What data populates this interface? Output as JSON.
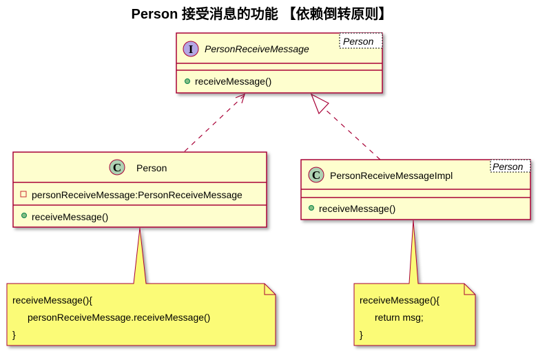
{
  "title": "Person 接受消息的功能 【依赖倒转原则】",
  "interface": {
    "stereotype_letter": "I",
    "name": "PersonReceiveMessage",
    "generic": "Person",
    "methods": [
      "receiveMessage()"
    ]
  },
  "person": {
    "stereotype_letter": "C",
    "name": "Person",
    "fields": [
      "personReceiveMessage:PersonReceiveMessage"
    ],
    "methods": [
      "receiveMessage()"
    ]
  },
  "impl": {
    "stereotype_letter": "C",
    "name": "PersonReceiveMessageImpl",
    "generic": "Person",
    "methods": [
      "receiveMessage()"
    ]
  },
  "note_person": [
    "receiveMessage(){",
    "personReceiveMessage.receiveMessage()",
    "}"
  ],
  "note_impl": [
    "receiveMessage(){",
    "return msg;",
    "}"
  ],
  "colors": {
    "border": "#A80036",
    "class_fill": "#FEFECE",
    "note_fill": "#FBFB77",
    "interface_badge": "#B4A7E5",
    "class_badge": "#ADD1B2"
  }
}
